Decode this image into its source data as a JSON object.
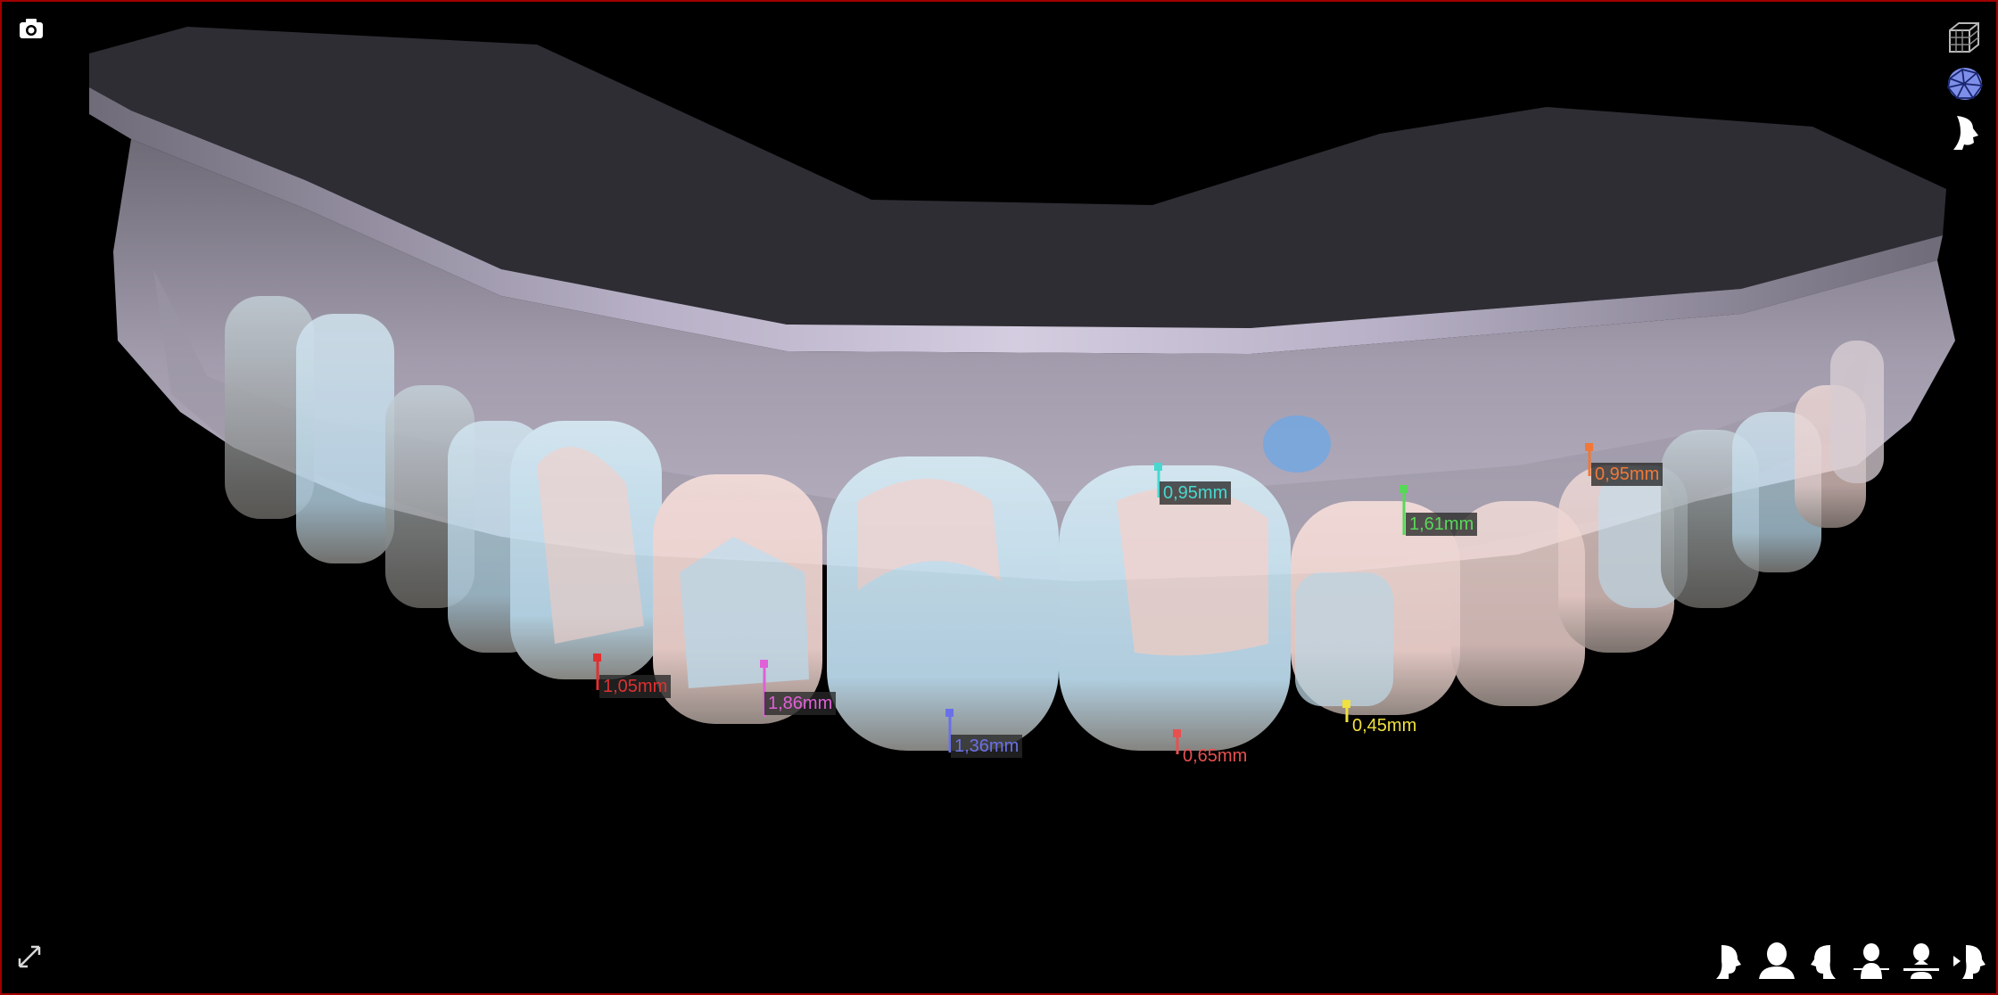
{
  "viewport": {
    "frame_color": "#a00000",
    "background": "#000000"
  },
  "toolbar_top_left": {
    "icon": "camera-icon"
  },
  "toolbar_top_right": [
    {
      "icon": "grid-cube-icon"
    },
    {
      "icon": "mesh-sphere-icon"
    },
    {
      "icon": "profile-face-icon"
    }
  ],
  "toolbar_bottom_left": {
    "icon": "expand-icon"
  },
  "view_presets": [
    {
      "icon": "view-right-icon"
    },
    {
      "icon": "view-front-icon"
    },
    {
      "icon": "view-left-icon"
    },
    {
      "icon": "view-top-icon"
    },
    {
      "icon": "view-bottom-icon"
    },
    {
      "icon": "view-back-icon"
    }
  ],
  "measurements": [
    {
      "label": "1,05mm",
      "color": "#e03030",
      "boxed": true
    },
    {
      "label": "1,86mm",
      "color": "#e060d8",
      "boxed": true
    },
    {
      "label": "1,36mm",
      "color": "#6a70e8",
      "boxed": true
    },
    {
      "label": "0,95mm",
      "color": "#48d8d0",
      "boxed": true
    },
    {
      "label": "0,65mm",
      "color": "#e85050",
      "boxed": false
    },
    {
      "label": "0,45mm",
      "color": "#f0e040",
      "boxed": false
    },
    {
      "label": "1,61mm",
      "color": "#58d858",
      "boxed": true
    },
    {
      "label": "0,95mm",
      "color": "#f07838",
      "boxed": true
    }
  ]
}
